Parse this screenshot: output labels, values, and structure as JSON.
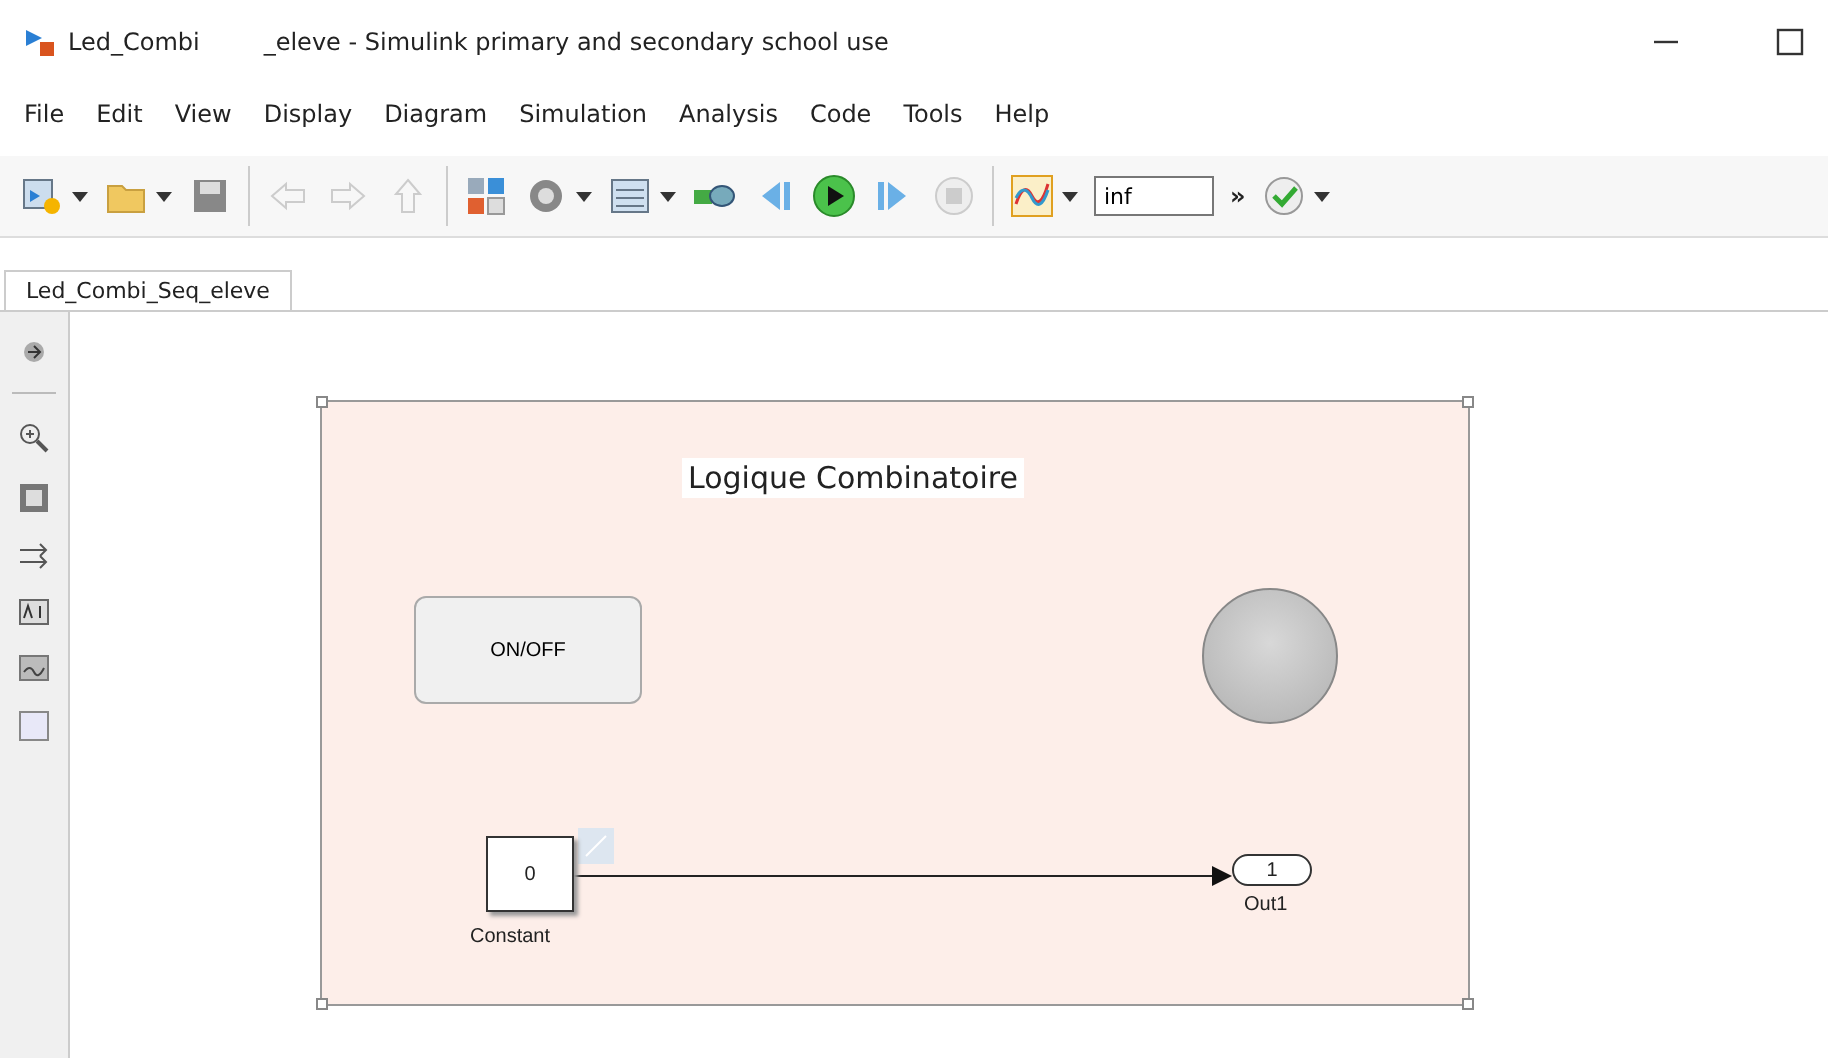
{
  "window": {
    "title_parts": [
      "Led_Combi",
      "_eleve - Simulink primary and secondary school use"
    ]
  },
  "menu": [
    "File",
    "Edit",
    "View",
    "Display",
    "Diagram",
    "Simulation",
    "Analysis",
    "Code",
    "Tools",
    "Help"
  ],
  "toolbar": {
    "stop_time": "inf",
    "overflow": "»"
  },
  "tabs": [
    {
      "label": "Led_Combi_Seq_eleve",
      "selected": true
    }
  ],
  "diagram": {
    "area_title": "Logique Combinatoire",
    "switch_label": "ON/OFF",
    "lamp_on": false,
    "blocks": [
      {
        "kind": "constant",
        "value": "0",
        "label": "Constant"
      },
      {
        "kind": "outport",
        "value": "1",
        "label": "Out1"
      }
    ]
  }
}
